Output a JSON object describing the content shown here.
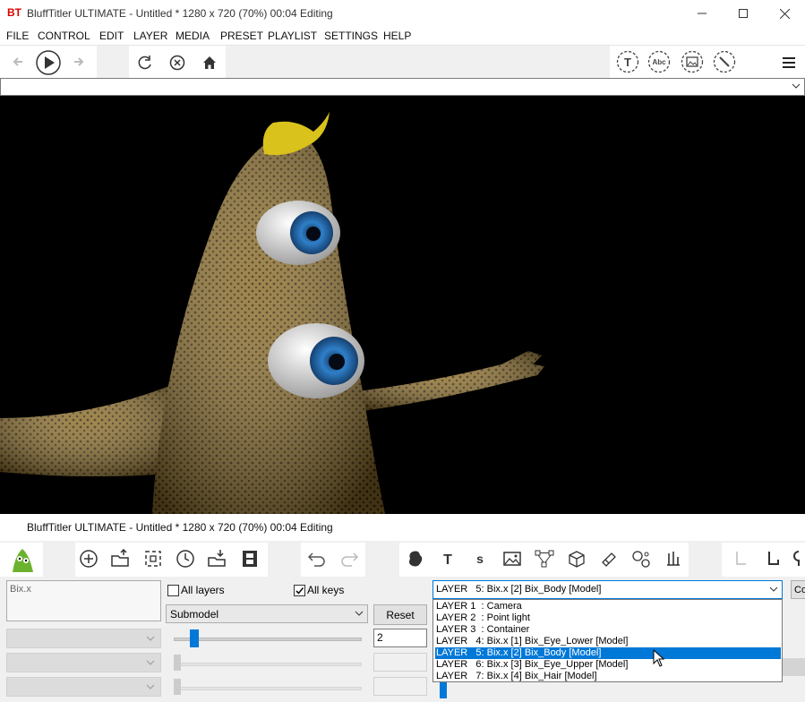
{
  "window": {
    "title": "BluffTitler ULTIMATE  - Untitled * 1280 x 720 (70%) 00:04 Editing",
    "logo_text": "BT"
  },
  "menu": [
    "FILE",
    "CONTROL",
    "EDIT",
    "LAYER",
    "MEDIA",
    "PRESET",
    "PLAYLIST",
    "SETTINGS",
    "HELP"
  ],
  "panel": {
    "title": "BluffTitler ULTIMATE  - Untitled * 1280 x 720 (70%) 00:04 Editing"
  },
  "layer_name_box": "Bix.x",
  "all_layers_label": "All layers",
  "all_keys_label": "All keys",
  "all_layers_checked": false,
  "all_keys_checked": true,
  "submodel_select": "Submodel",
  "reset_label": "Reset",
  "value_input": "2",
  "slider_value": 0.05,
  "layer_select": {
    "selected": "LAYER   5: Bix.x [2] Bix_Body [Model]",
    "options": [
      "LAYER 1  : Camera",
      "LAYER 2  : Point light",
      "LAYER 3  : Container",
      "LAYER   4: Bix.x [1] Bix_Eye_Lower [Model]",
      "LAYER   5: Bix.x [2] Bix_Body [Model]",
      "LAYER   6: Bix.x [3] Bix_Eye_Upper [Model]",
      "LAYER   7: Bix.x [4] Bix_Hair [Model]"
    ],
    "selected_index": 4
  },
  "cut_button_text": "Co",
  "colors": {
    "accent": "#0078d7",
    "preview_bg": "#000000",
    "body_color": "#8b6d2a",
    "iris": "#2f7fc8"
  }
}
